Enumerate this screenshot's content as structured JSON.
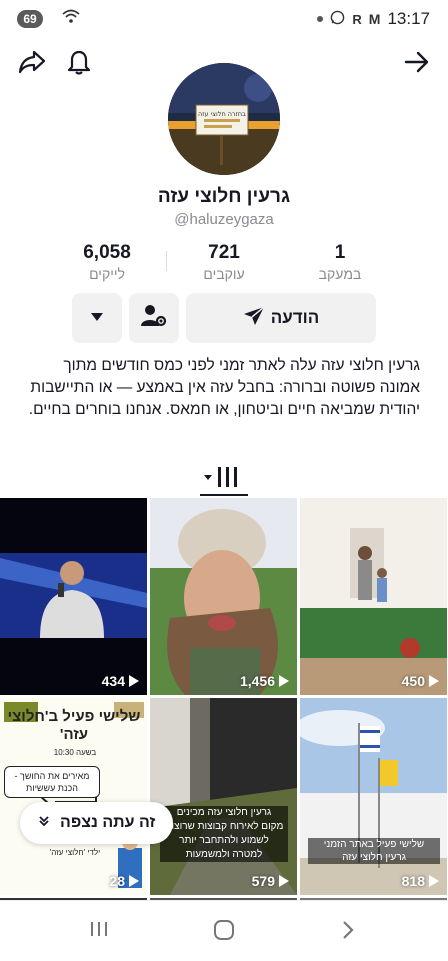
{
  "status_bar": {
    "battery": "69",
    "time": "13:17"
  },
  "profile": {
    "name": "גרעין חלוצי עזה",
    "handle": "@haluzeygaza",
    "avatar_sign_text": "בחזרה חלוצי עזה"
  },
  "stats": [
    {
      "value": "6,058",
      "label": "לייקים"
    },
    {
      "value": "721",
      "label": "עוקבים"
    },
    {
      "value": "1",
      "label": "במעקב"
    }
  ],
  "actions": {
    "message_label": "הודעה"
  },
  "bio": "גרעין חלוצי עזה עלה לאתר זמני לפני כמס חודשים מתוך אמונה פשוטה וברורה: בחבל עזה אין באמצע — או התיישבות יהודית שמביאה חיים וביטחון, או חמאס. אנחנו בוחרים בחיים.",
  "videos": [
    {
      "views": "434",
      "overlay": ""
    },
    {
      "views": "1,456",
      "overlay": ""
    },
    {
      "views": "450",
      "overlay": ""
    },
    {
      "views": "28",
      "overlay_title": "שלישי פעיל ב'חלוצי עזה'",
      "overlay_sub": "מאירים את החושך - הכנת עששיות",
      "overlay_footer": "ילדי 'חלוצי עזה'",
      "overlay_small": "בשעה 10:30"
    },
    {
      "views": "579",
      "overlay_lines": [
        "גרעין חלוצי עזה מכינים",
        "מקום לאירוח קבוצות שרוצות",
        "לשמוע ולהתחבר יותר",
        "למטרה ולמשמעות"
      ]
    },
    {
      "views": "818",
      "overlay_lines": [
        "שלישי פעיל באתר הזמני",
        "גרעין חלוצי עזה"
      ]
    }
  ],
  "now_watching": "זה עתה נצפה",
  "colors": {
    "accent": "#161823",
    "muted": "#8a8b91",
    "button_bg": "#f1f1f2"
  }
}
